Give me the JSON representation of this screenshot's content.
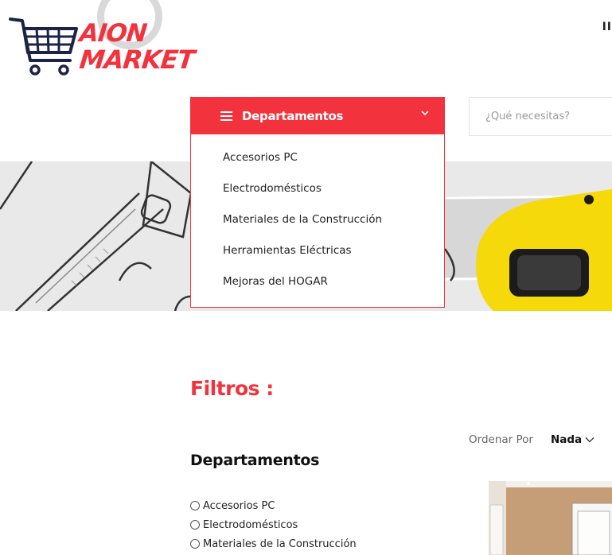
{
  "logo": {
    "line1": "AION",
    "line2": "MARKET"
  },
  "header": {
    "top_right_text": "II"
  },
  "departments_button": {
    "label": "Departamentos",
    "icon": "menu-icon",
    "chevron": "chevron-down-icon"
  },
  "search": {
    "placeholder": "¿Qué necesitas?"
  },
  "dropdown": {
    "items": [
      {
        "label": "Accesorios PC"
      },
      {
        "label": "Electrodomésticos"
      },
      {
        "label": "Materiales de la Construcción"
      },
      {
        "label": "Herramientas Eléctricas"
      },
      {
        "label": "Mejoras del HOGAR"
      }
    ]
  },
  "filters": {
    "title": "Filtros :",
    "sort_label": "Ordenar Por",
    "sort_value": "Nada",
    "departments_heading": "Departamentos",
    "department_options": [
      {
        "label": "Accesorios PC"
      },
      {
        "label": "Electrodomésticos"
      },
      {
        "label": "Materiales de la Construcción"
      }
    ]
  },
  "colors": {
    "accent": "#f2323d",
    "navy": "#1c2346",
    "hero_bg": "#e9e9e9",
    "tool_yellow": "#f5d90a"
  }
}
